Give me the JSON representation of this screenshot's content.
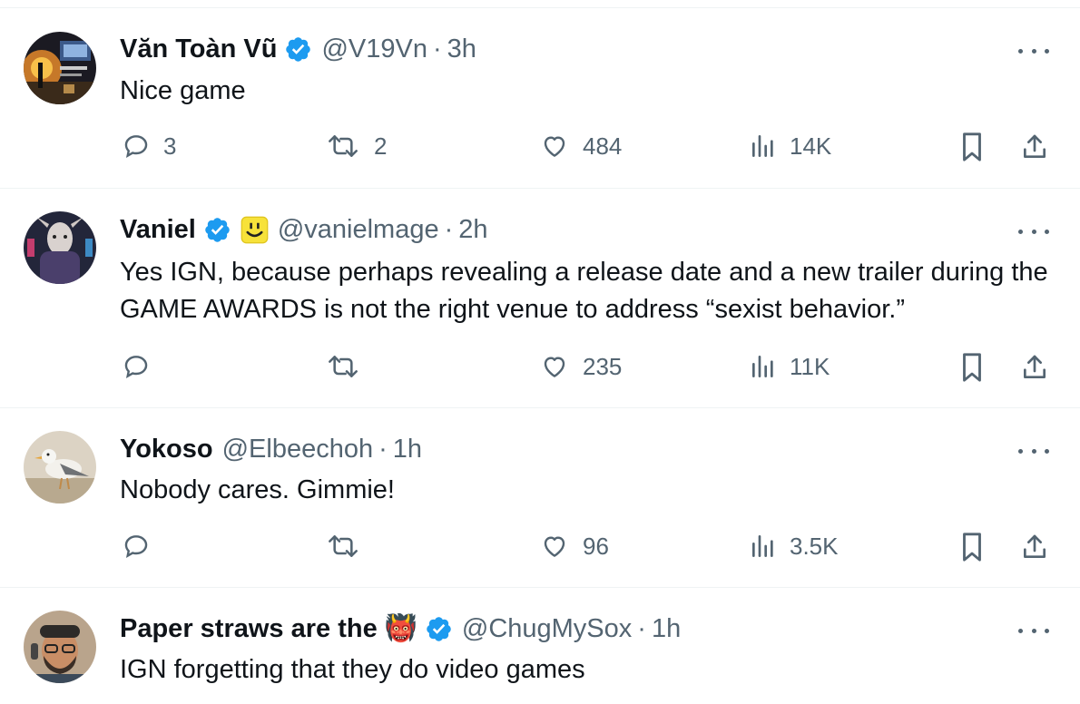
{
  "tweets": [
    {
      "name": "Văn Toàn Vũ",
      "handle": "@V19Vn",
      "separator": "·",
      "time": "3h",
      "text": "Nice game",
      "replies": "3",
      "reposts": "2",
      "likes": "484",
      "views": "14K"
    },
    {
      "name": "Vaniel",
      "handle": "@vanielmage",
      "separator": "·",
      "time": "2h",
      "text": "Yes IGN, because perhaps revealing a release date and a new trailer during the GAME AWARDS is not the right venue to address “sexist behavior.”",
      "replies": "",
      "reposts": "",
      "likes": "235",
      "views": "11K"
    },
    {
      "name": "Yokoso",
      "handle": "@Elbeechoh",
      "separator": "·",
      "time": "1h",
      "text": "Nobody cares. Gimmie!",
      "replies": "",
      "reposts": "",
      "likes": "96",
      "views": "3.5K"
    },
    {
      "name": "Paper straws are the 👹",
      "handle": "@ChugMySox",
      "separator": "·",
      "time": "1h",
      "text": "IGN forgetting that they do video games"
    }
  ],
  "icons": {
    "reply": "reply-icon",
    "repost": "repost-icon",
    "like": "heart-icon",
    "views": "views-icon",
    "bookmark": "bookmark-icon",
    "share": "share-icon",
    "verified": "verified-badge-icon",
    "more": "more-icon"
  },
  "colors": {
    "verified": "#1d9bf0",
    "muted": "#536471",
    "text": "#0f1419",
    "divider": "#eff3f4"
  }
}
